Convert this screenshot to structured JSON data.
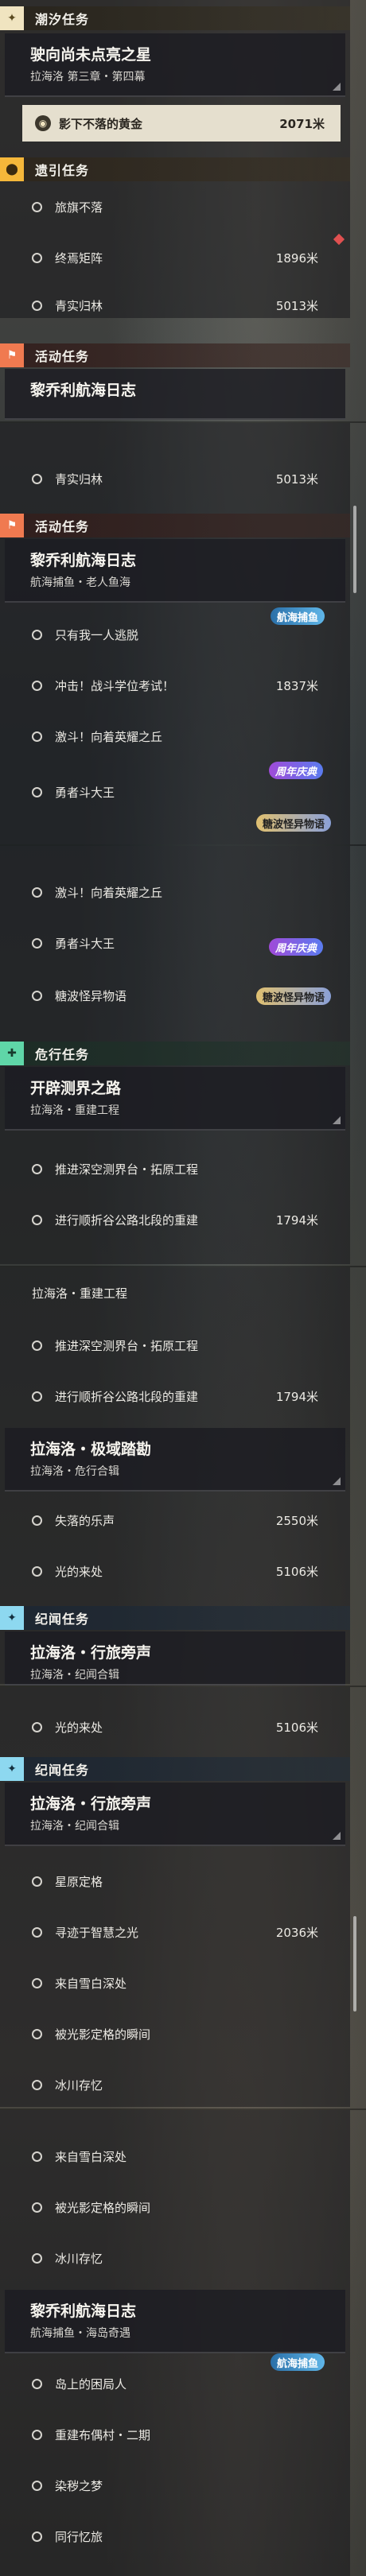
{
  "headers": {
    "tide": "潮汐任务",
    "guide": "遗引任务",
    "activity": "活动任务",
    "danger": "危行任务",
    "chronicle": "纪闻任务"
  },
  "tide_quest": {
    "title": "驶向尚未点亮之星",
    "subtitle": "拉海洛 第三章・第四幕"
  },
  "selected": {
    "label": "影下不落的黄金",
    "dist": "2071米"
  },
  "guide_items": [
    {
      "label": "旅旗不落",
      "dist": ""
    },
    {
      "label": "终焉矩阵",
      "dist": "1896米"
    },
    {
      "label": "青实归林",
      "dist": "5013米"
    }
  ],
  "activity_quest": {
    "title": "黎乔利航海日志",
    "subtitle": "航海捕鱼・老人鱼海"
  },
  "activity_items": [
    {
      "label": "只有我一人逃脱",
      "dist": ""
    },
    {
      "label": "冲击！战斗学位考试！",
      "dist": "1837米"
    },
    {
      "label": "激斗！向着英耀之丘",
      "dist": ""
    },
    {
      "label": "勇者斗大王",
      "dist": ""
    },
    {
      "label": "糖波怪异物语",
      "dist": ""
    }
  ],
  "badges": {
    "sea": "航海捕鱼",
    "anniv": "周年庆典",
    "story": "糖波怪异物语"
  },
  "danger_quest1": {
    "title": "开辟测界之路",
    "subtitle": "拉海洛・重建工程"
  },
  "danger_items1": [
    {
      "label": "推进深空测界台・拓原工程",
      "dist": ""
    },
    {
      "label": "进行顺折谷公路北段的重建",
      "dist": "1794米"
    }
  ],
  "danger_cut": "拉海洛・重建工程",
  "danger_quest2": {
    "title": "拉海洛・极域踏勘",
    "subtitle": "拉海洛・危行合辑"
  },
  "danger_items2": [
    {
      "label": "失落的乐声",
      "dist": "2550米"
    },
    {
      "label": "光的来处",
      "dist": "5106米"
    }
  ],
  "chronicle_quest": {
    "title": "拉海洛・行旅旁声",
    "subtitle": "拉海洛・纪闻合辑"
  },
  "chronicle_items": [
    {
      "label": "星原定格",
      "dist": ""
    },
    {
      "label": "寻迹于智慧之光",
      "dist": "2036米"
    },
    {
      "label": "来自雪白深处",
      "dist": ""
    },
    {
      "label": "被光影定格的瞬间",
      "dist": ""
    },
    {
      "label": "冰川存忆",
      "dist": ""
    }
  ],
  "activity_quest2": {
    "title": "黎乔利航海日志",
    "subtitle": "航海捕鱼・海岛奇遇"
  },
  "activity_items2": [
    {
      "label": "岛上的困局人",
      "dist": ""
    },
    {
      "label": "重建布偶村・二期",
      "dist": ""
    },
    {
      "label": "染秽之梦",
      "dist": ""
    },
    {
      "label": "同行忆旅",
      "dist": ""
    }
  ],
  "icons": {
    "tide": "star-icon",
    "guide": "location-pin-icon",
    "activity": "flag-icon",
    "danger": "shield-icon",
    "chronicle": "star-icon",
    "selected": "target-icon"
  }
}
